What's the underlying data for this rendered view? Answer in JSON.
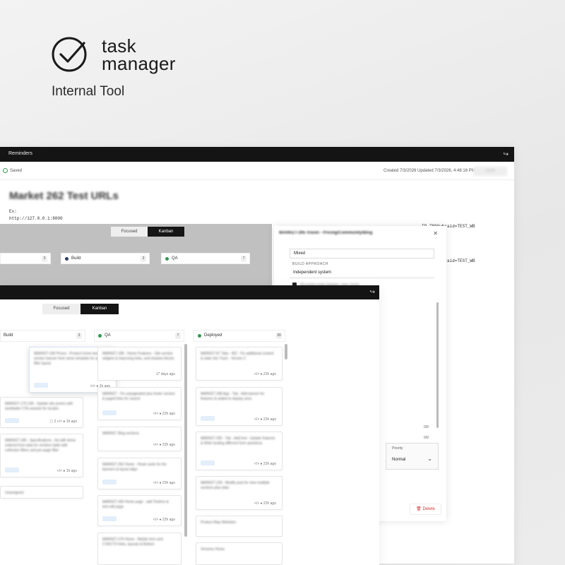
{
  "brand": {
    "title_line1": "task",
    "title_line2": "manager",
    "subtitle": "Internal Tool"
  },
  "back_window": {
    "nav_title": "Reminders",
    "status": "Saved",
    "created": "Created 7/3/2026",
    "updated": "Updated 7/3/2026, 4:48:16 PM",
    "action_button": "Save",
    "doc_title": "Market 262 Test URLs",
    "body_line1": "Ex:",
    "body_line2": "http://127.0.0.1:8000",
    "url_tail": "ID_789&wbraid=TEST_WB",
    "url_tail2": "ID_789&wbraid=TEST_WB",
    "toggle": {
      "focused": "Focused",
      "kanban": "Kanban"
    },
    "columns": [
      {
        "label": "Build",
        "count": "3"
      },
      {
        "label": "QA",
        "count": "7"
      }
    ],
    "col0_count": "3",
    "modal": {
      "title": "MARKET-295 Vision - Pricing/Community/Blog",
      "field1": "Mixed",
      "build_label": "BUILD APPROACH",
      "build_value": "Independent system",
      "assets_label": "All assets ready (images, copy, icons)",
      "sel1": "0/9",
      "sel2": "0/9",
      "priority_label": "Priority",
      "priority_value": "Normal",
      "delete_label": "Delete"
    }
  },
  "front_window": {
    "toggle": {
      "focused": "Focused",
      "kanban": "Kanban"
    },
    "columns": [
      {
        "label": "Build",
        "count": "3",
        "color": "#2b3a66"
      },
      {
        "label": "QA",
        "count": "7",
        "color": "#2e9a52"
      },
      {
        "label": "Deployed",
        "count": "30",
        "color": "#2e9a52"
      }
    ],
    "build_cards": [
      {
        "text": "MARKET-330 Prices - Product home landing section banner from stone template for quick filter layout",
        "meta": "1h ago"
      },
      {
        "text": "MARKET-170-199 - Update site promo with worldwide CTA variants for locales",
        "meta": "1h ago"
      },
      {
        "text": "MARKET-185 - Specifications - list with items ordered from data for vendors table with collection filters and per-page filter",
        "meta": "1h ago"
      },
      {
        "text": "Unassigned",
        "meta": ""
      }
    ],
    "qa_cards": [
      {
        "text": "MARKET-298 - Home Features - Site section widgets & improving links, and shadow blocks",
        "meta": "17 days ago"
      },
      {
        "text": "MARKET - Fix unpaginated plus footer section & paged links for search",
        "meta": "22h ago"
      },
      {
        "text": "MARKET Blog sections",
        "meta": "22h ago"
      },
      {
        "text": "MARKET-250 Home - Head cards for the banners & layout align",
        "meta": "22h ago"
      },
      {
        "text": "MARKET-490 Home page - add Testimo & text edit page",
        "meta": "22h ago"
      },
      {
        "text": "MARKET-270 Home - Mobile hero and CTA/CTO links, layouts & Bottom",
        "meta": ""
      }
    ],
    "deployed_cards": [
      {
        "text": "MARKET-87 Tabs - BIZ - Fix additional content & state into Track - Version 2",
        "meta": "22h ago"
      },
      {
        "text": "MARKET-298 App - Tab - Add banner for features & added to display area",
        "meta": "22h ago"
      },
      {
        "text": "MARKET-200 - Tab - Add text - Update features & Write landing different form questions",
        "meta": "22h ago"
      },
      {
        "text": "MARKET-109 - Modify post for view multiple sections plus data",
        "meta": "22h ago"
      },
      {
        "text": "Product Map Websites",
        "meta": ""
      },
      {
        "text": "Versions Home",
        "meta": ""
      }
    ],
    "card_meta": {
      "build_comments": "2"
    }
  }
}
